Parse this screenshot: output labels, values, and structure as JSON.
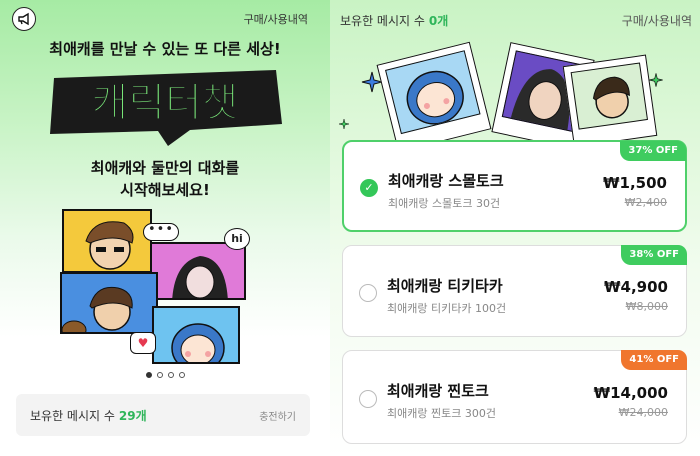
{
  "left": {
    "history_link": "구매/사용내역",
    "tagline": "최애캐를 만날 수 있는 또 다른 세상!",
    "logo_text": "캐릭터챗",
    "sub_line1": "최애캐와 둘만의 대화를",
    "sub_line2": "시작해보세요!",
    "bubble_dots": "•••",
    "bubble_hi": "hi",
    "bubble_heart": "♥",
    "wallet": {
      "label": "보유한 메시지 수",
      "count": "29개",
      "charge": "충전하기"
    },
    "pager": {
      "total": 4,
      "active": 1
    }
  },
  "right": {
    "message_label": "보유한 메시지 수",
    "message_count": "0개",
    "history_link": "구매/사용내역",
    "packages": [
      {
        "name": "최애캐랑 스몰토크",
        "desc": "최애캐랑 스몰토크 30건",
        "price": "₩1,500",
        "original": "₩2,400",
        "discount": "37% OFF",
        "badge_color": "#3fcc5f",
        "selected": true
      },
      {
        "name": "최애캐랑 티키타카",
        "desc": "최애캐랑 티키타카 100건",
        "price": "₩4,900",
        "original": "₩8,000",
        "discount": "38% OFF",
        "badge_color": "#3fcc5f",
        "selected": false
      },
      {
        "name": "최애캐랑 찐토크",
        "desc": "최애캐랑 찐토크 300건",
        "price": "₩14,000",
        "original": "₩24,000",
        "discount": "41% OFF",
        "badge_color": "#f0762e",
        "selected": false
      }
    ]
  },
  "colors": {
    "accent_green": "#34c759",
    "brand_green": "#2fb55a",
    "discount_orange": "#f0762e"
  }
}
